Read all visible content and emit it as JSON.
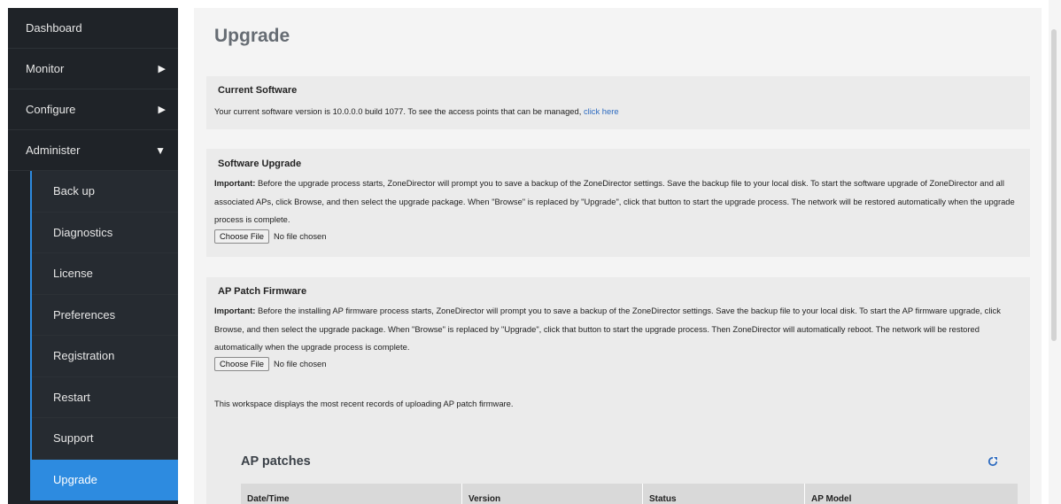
{
  "sidebar": {
    "top_items": [
      {
        "label": "Dashboard",
        "arrow": ""
      },
      {
        "label": "Monitor",
        "arrow": "▶"
      },
      {
        "label": "Configure",
        "arrow": "▶"
      },
      {
        "label": "Administer",
        "arrow": "▼"
      }
    ],
    "sub_items": [
      {
        "label": "Back up"
      },
      {
        "label": "Diagnostics"
      },
      {
        "label": "License"
      },
      {
        "label": "Preferences"
      },
      {
        "label": "Registration"
      },
      {
        "label": "Restart"
      },
      {
        "label": "Support"
      },
      {
        "label": "Upgrade"
      }
    ],
    "active_item": "Upgrade"
  },
  "page": {
    "title": "Upgrade"
  },
  "current_software": {
    "heading": "Current Software",
    "text": "Your current software version is 10.0.0.0 build 1077. To see the access points that can be managed, ",
    "link": "click here"
  },
  "software_upgrade": {
    "heading": "Software Upgrade",
    "important_label": "Important:",
    "text": " Before the upgrade process starts, ZoneDirector will prompt you to save a backup of the ZoneDirector settings. Save the backup file to your local disk. To start the software upgrade of ZoneDirector and all associated APs, click Browse, and then select the upgrade package. When \"Browse\" is replaced by \"Upgrade\", click that button to start the upgrade process. The network will be restored automatically when the upgrade process is complete.",
    "choose_file_label": "Choose File",
    "file_status": "No file chosen"
  },
  "ap_patch": {
    "heading": "AP Patch Firmware",
    "important_label": "Important:",
    "text": " Before the installing AP firmware process starts, ZoneDirector will prompt you to save a backup of the ZoneDirector settings. Save the backup file to your local disk. To start the AP firmware upgrade, click Browse, and then select the upgrade package. When \"Browse\" is replaced by \"Upgrade\", click that button to start the upgrade process. Then ZoneDirector will automatically reboot. The network will be restored automatically when the upgrade process is complete.",
    "choose_file_label": "Choose File",
    "file_status": "No file chosen",
    "note": "This workspace displays the most recent records of uploading AP patch firmware."
  },
  "ap_patches": {
    "title": "AP patches",
    "columns": [
      "Date/Time",
      "Version",
      "Status",
      "AP Model"
    ]
  },
  "colors": {
    "sidebar_bg": "#1f2328",
    "accent": "#2d8be0",
    "link": "#2d6bc0"
  }
}
